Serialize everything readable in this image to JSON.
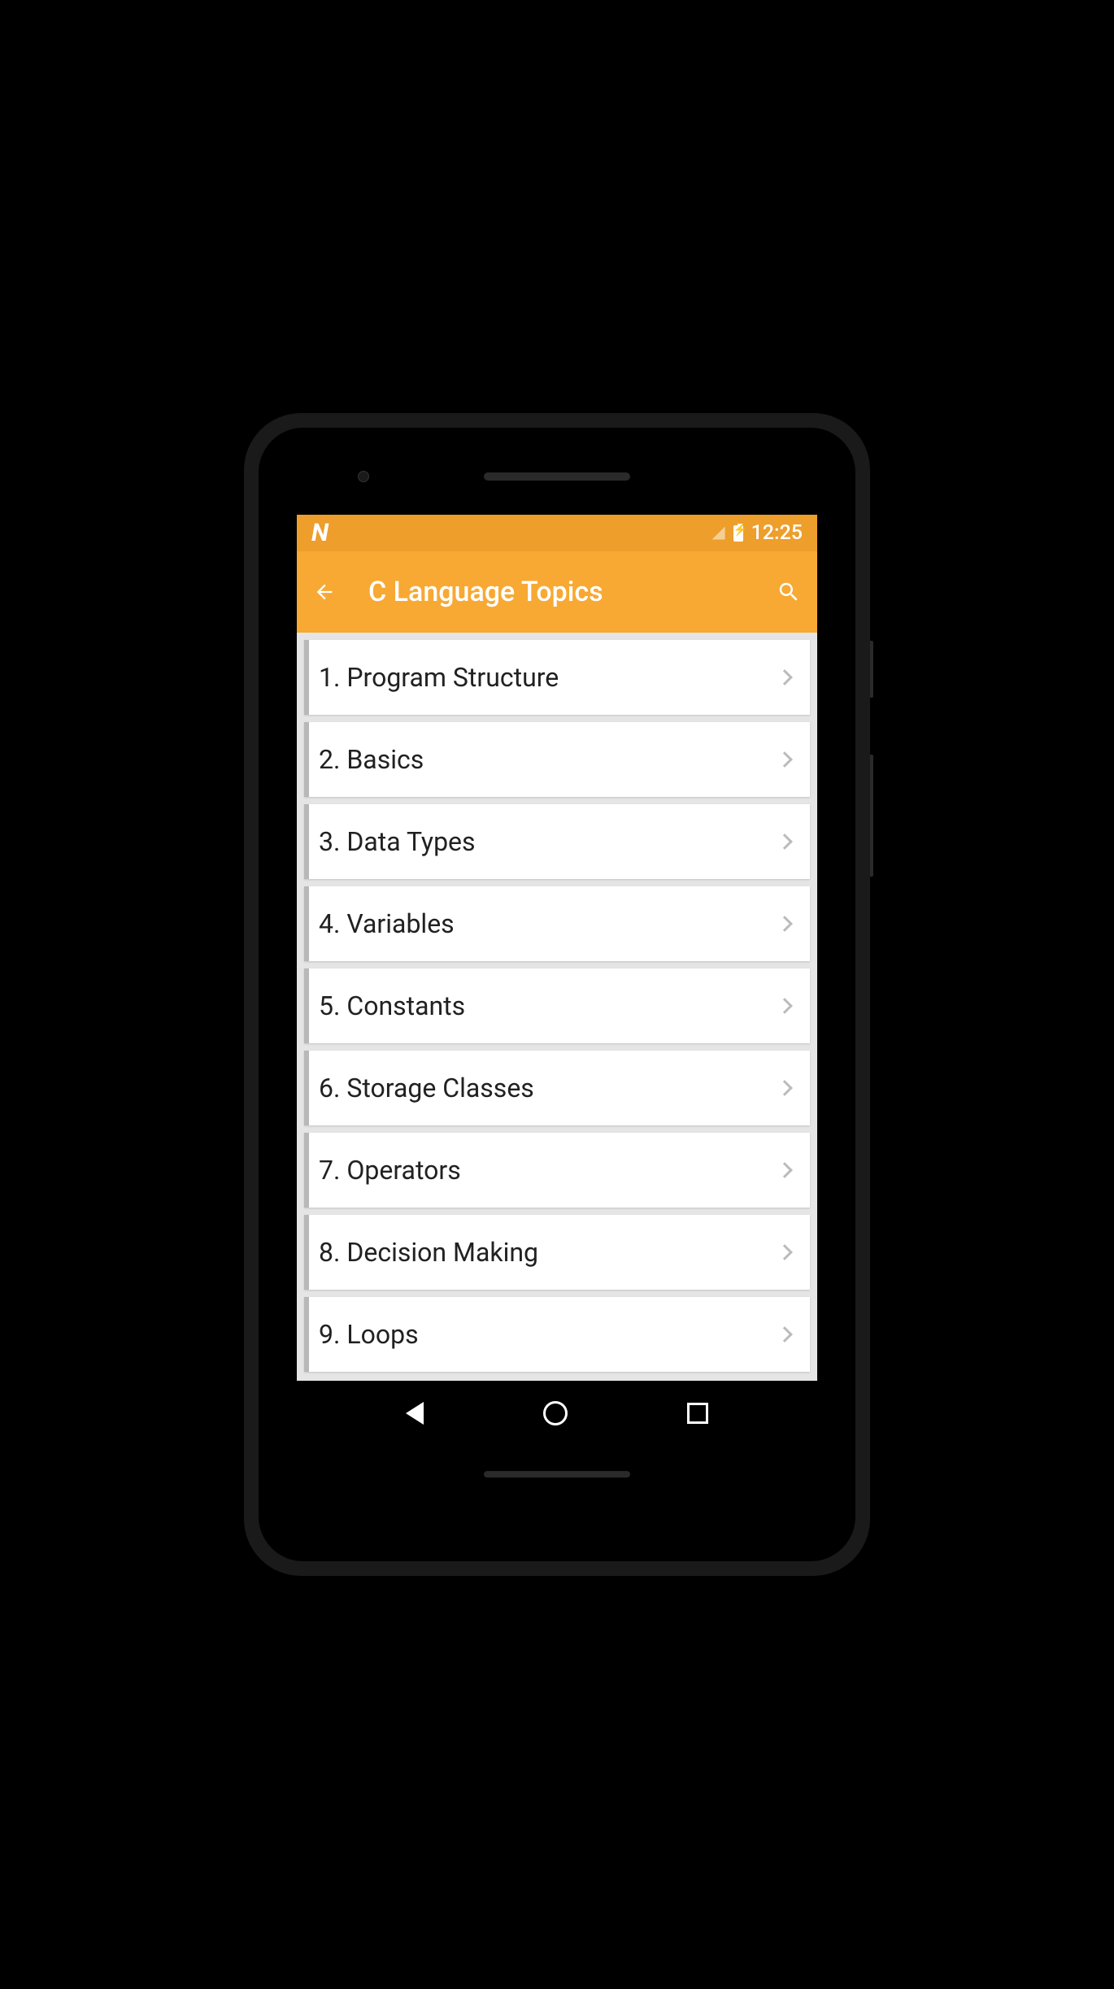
{
  "status_bar": {
    "time": "12:25"
  },
  "app_bar": {
    "title": "C Language Topics"
  },
  "topics": [
    {
      "label": "1. Program Structure"
    },
    {
      "label": "2. Basics"
    },
    {
      "label": "3. Data Types"
    },
    {
      "label": "4. Variables"
    },
    {
      "label": "5. Constants"
    },
    {
      "label": "6. Storage Classes"
    },
    {
      "label": "7. Operators"
    },
    {
      "label": "8. Decision Making"
    },
    {
      "label": "9. Loops"
    }
  ]
}
